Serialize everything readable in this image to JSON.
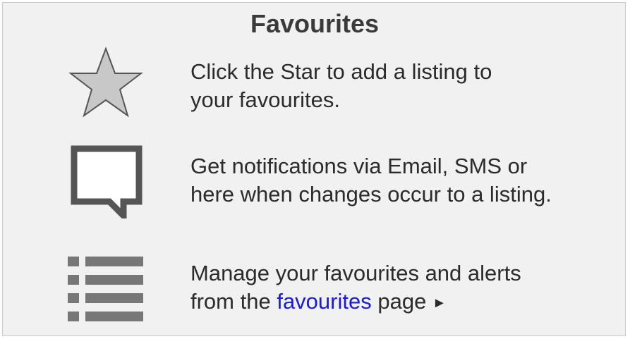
{
  "panel": {
    "title": "Favourites",
    "items": [
      {
        "icon": "star-icon",
        "line1": "Click the Star to add a listing to",
        "line2": "your favourites."
      },
      {
        "icon": "speech-bubble-icon",
        "line1": "Get notifications via Email, SMS or",
        "line2": "here when changes occur to a listing."
      },
      {
        "icon": "list-icon",
        "line1": "Manage your favourites and alerts",
        "line2_before": "from the ",
        "link": "favourites",
        "line2_after": " page ",
        "arrow": "►"
      }
    ]
  },
  "colors": {
    "background": "#f1f1f1",
    "text": "#2b2b2b",
    "link": "#1a1adf",
    "icon": "#555555",
    "star_fill": "#c8c8c8"
  }
}
